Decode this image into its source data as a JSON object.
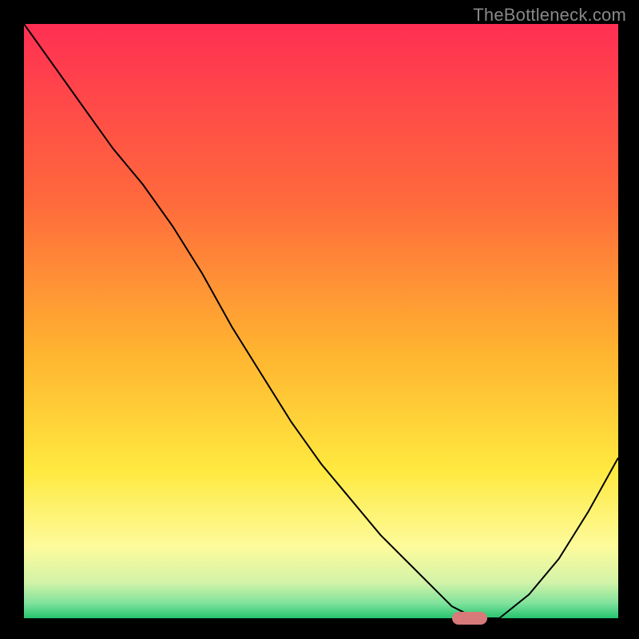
{
  "watermark": "TheBottleneck.com",
  "chart_data": {
    "type": "line",
    "title": "",
    "xlabel": "",
    "ylabel": "",
    "xlim": [
      0,
      100
    ],
    "ylim": [
      0,
      100
    ],
    "grid": false,
    "legend": false,
    "background_gradient": {
      "stops": [
        {
          "pos": 0.0,
          "color": "#ff2f53"
        },
        {
          "pos": 0.3,
          "color": "#ff6a3c"
        },
        {
          "pos": 0.55,
          "color": "#ffb330"
        },
        {
          "pos": 0.75,
          "color": "#ffe93f"
        },
        {
          "pos": 0.88,
          "color": "#fdfb9c"
        },
        {
          "pos": 0.94,
          "color": "#d2f3a8"
        },
        {
          "pos": 0.975,
          "color": "#7fe29c"
        },
        {
          "pos": 1.0,
          "color": "#25c46f"
        }
      ]
    },
    "series": [
      {
        "name": "bottleneck-curve",
        "color": "#000000",
        "width": 2,
        "x": [
          0,
          5,
          10,
          15,
          20,
          25,
          30,
          35,
          40,
          45,
          50,
          55,
          60,
          65,
          70,
          72,
          76,
          80,
          85,
          90,
          95,
          100
        ],
        "y": [
          100,
          93,
          86,
          79,
          73,
          66,
          58,
          49,
          41,
          33,
          26,
          20,
          14,
          9,
          4,
          2,
          0,
          0,
          4,
          10,
          18,
          27
        ]
      }
    ],
    "marker": {
      "shape": "rounded-rect",
      "color": "#d87a7a",
      "x": 75,
      "y": 0,
      "width_pct": 6,
      "height_pct": 2.2
    }
  }
}
